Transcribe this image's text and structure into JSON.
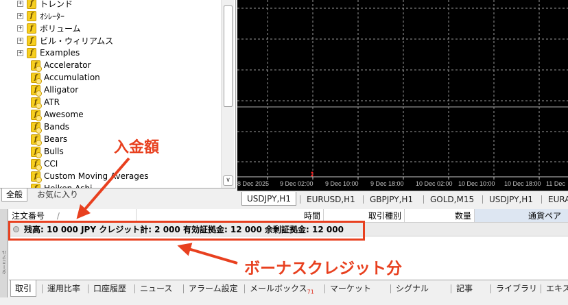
{
  "navigator": {
    "items": [
      {
        "label": "トレンド",
        "type": "folder",
        "icon": "indicator-folder-icon"
      },
      {
        "label": "ｵｼﾚｰﾀｰ",
        "type": "folder",
        "icon": "indicator-folder-icon"
      },
      {
        "label": "ボリューム",
        "type": "folder",
        "icon": "indicator-folder-icon"
      },
      {
        "label": "ビル・ウィリアムス",
        "type": "folder",
        "icon": "indicator-folder-icon"
      },
      {
        "label": "Examples",
        "type": "folder",
        "icon": "indicator-folder-icon"
      },
      {
        "label": "Accelerator",
        "type": "leaf",
        "icon": "indicator-icon"
      },
      {
        "label": "Accumulation",
        "type": "leaf",
        "icon": "indicator-icon"
      },
      {
        "label": "Alligator",
        "type": "leaf",
        "icon": "indicator-icon"
      },
      {
        "label": "ATR",
        "type": "leaf",
        "icon": "indicator-icon"
      },
      {
        "label": "Awesome",
        "type": "leaf",
        "icon": "indicator-icon"
      },
      {
        "label": "Bands",
        "type": "leaf",
        "icon": "indicator-icon"
      },
      {
        "label": "Bears",
        "type": "leaf",
        "icon": "indicator-icon"
      },
      {
        "label": "Bulls",
        "type": "leaf",
        "icon": "indicator-icon"
      },
      {
        "label": "CCI",
        "type": "leaf",
        "icon": "indicator-icon"
      },
      {
        "label": "Custom Moving Averages",
        "type": "leaf",
        "icon": "indicator-icon"
      },
      {
        "label": "Heiken Ashi",
        "type": "leaf",
        "icon": "indicator-icon"
      }
    ],
    "expander_symbol": "+",
    "folder_glyph": "f",
    "scroll_down_glyph": "∨",
    "tabs": [
      {
        "label": "全般",
        "active": true
      },
      {
        "label": "お気に入り",
        "active": false
      }
    ]
  },
  "chart": {
    "background": "#000000",
    "grid_color": "#9a9a9a",
    "price_line_color": "#b0b0b0",
    "axis_color": "#c8c8c8",
    "marker_color": "#ff2020",
    "time_labels": [
      "8 Dec 2025",
      "9 Dec 02:00",
      "9 Dec 10:00",
      "9 Dec 18:00",
      "10 Dec 02:00",
      "10 Dec 10:00",
      "10 Dec 18:00",
      "11 Dec"
    ],
    "tabs": [
      {
        "label": "USDJPY,H1",
        "active": true
      },
      {
        "label": "EURUSD,H1",
        "active": false
      },
      {
        "label": "GBPJPY,H1",
        "active": false
      },
      {
        "label": "GOLD,M15",
        "active": false
      },
      {
        "label": "USDJPY,H1",
        "active": false
      },
      {
        "label": "EURA",
        "active": false
      }
    ]
  },
  "terminal": {
    "side_label": "ターミナル",
    "columns": [
      {
        "label": "注文番号",
        "sort_glyph": "/"
      },
      {
        "label": "時間"
      },
      {
        "label": "取引種別"
      },
      {
        "label": "数量"
      },
      {
        "label": "通貨ペア"
      }
    ],
    "balance_text": "残高: 10 000 JPY  クレジット計: 2 000  有効証拠金: 12 000  余剰証拠金: 12 000",
    "tabs": [
      {
        "label": "取引",
        "active": true
      },
      {
        "label": "運用比率"
      },
      {
        "label": "口座履歴"
      },
      {
        "label": "ニュース"
      },
      {
        "label": "アラーム設定"
      },
      {
        "label": "メールボックス",
        "badge": "71"
      },
      {
        "label": "マーケット"
      },
      {
        "label": "シグナル"
      },
      {
        "label": "記事"
      },
      {
        "label": "ライブラリ"
      },
      {
        "label": "エキスパート"
      }
    ]
  },
  "annotations": {
    "color": "#e8401f",
    "deposit_label": "入金額",
    "bonus_label": "ボーナスクレジット分"
  }
}
